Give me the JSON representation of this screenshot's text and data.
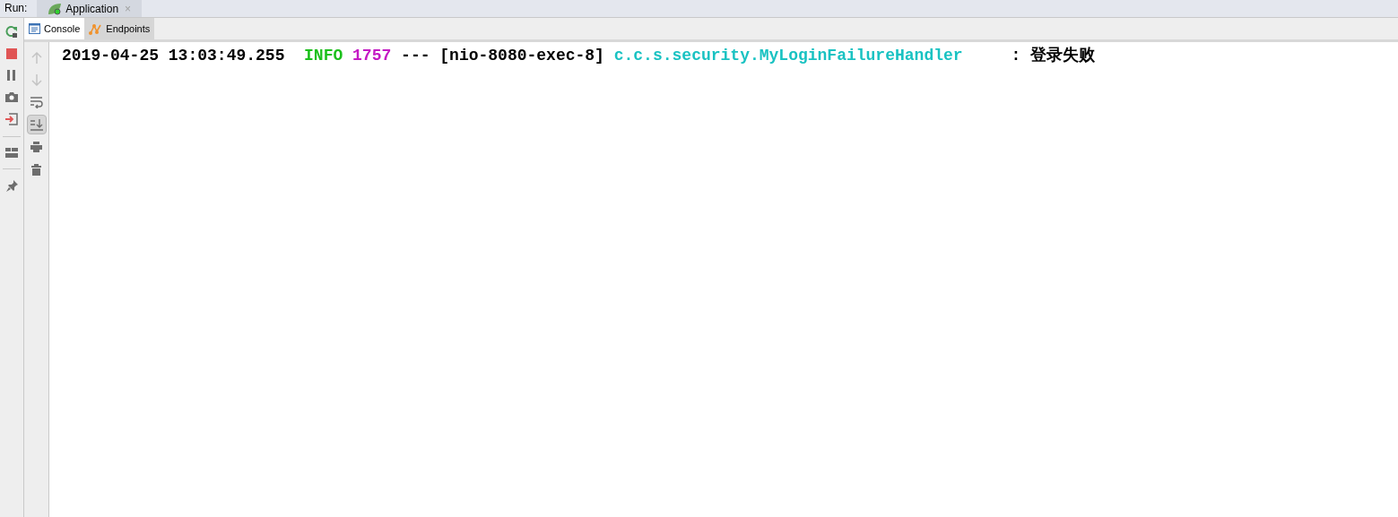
{
  "run_bar": {
    "label": "Run:",
    "tabs": [
      {
        "title": "Application",
        "selected": true,
        "close": "×"
      }
    ]
  },
  "left_toolbar": [
    {
      "kind": "rerun"
    },
    {
      "kind": "stop"
    },
    {
      "kind": "pause"
    },
    {
      "kind": "camera"
    },
    {
      "kind": "exit"
    },
    {
      "kind": "sep"
    },
    {
      "kind": "layout"
    },
    {
      "kind": "sep"
    },
    {
      "kind": "pin"
    }
  ],
  "console_tabs": [
    {
      "label": "Console",
      "kind": "console",
      "selected": true
    },
    {
      "label": "Endpoints",
      "kind": "endpoints",
      "selected": false
    }
  ],
  "console_toolbar": [
    {
      "kind": "up",
      "disabled": true,
      "selected": false
    },
    {
      "kind": "down",
      "disabled": true,
      "selected": false
    },
    {
      "kind": "wrap",
      "disabled": false,
      "selected": false
    },
    {
      "kind": "scroll-end",
      "disabled": false,
      "selected": true
    },
    {
      "kind": "print",
      "disabled": false,
      "selected": false
    },
    {
      "kind": "trash",
      "disabled": false,
      "selected": false
    }
  ],
  "log_lines": [
    {
      "segments": [
        {
          "text": "2019-04-25 13:03:49.255  ",
          "color": "#000000"
        },
        {
          "text": "INFO ",
          "color": "#1cc01c"
        },
        {
          "text": "1757 ",
          "color": "#c41bc4"
        },
        {
          "text": "--- [nio-8080-exec-8] ",
          "color": "#000000"
        },
        {
          "text": "c.c.s.security.MyLoginFailureHandler",
          "color": "#19c2c2"
        },
        {
          "text": "     : 登录失败",
          "color": "#000000"
        }
      ]
    }
  ]
}
